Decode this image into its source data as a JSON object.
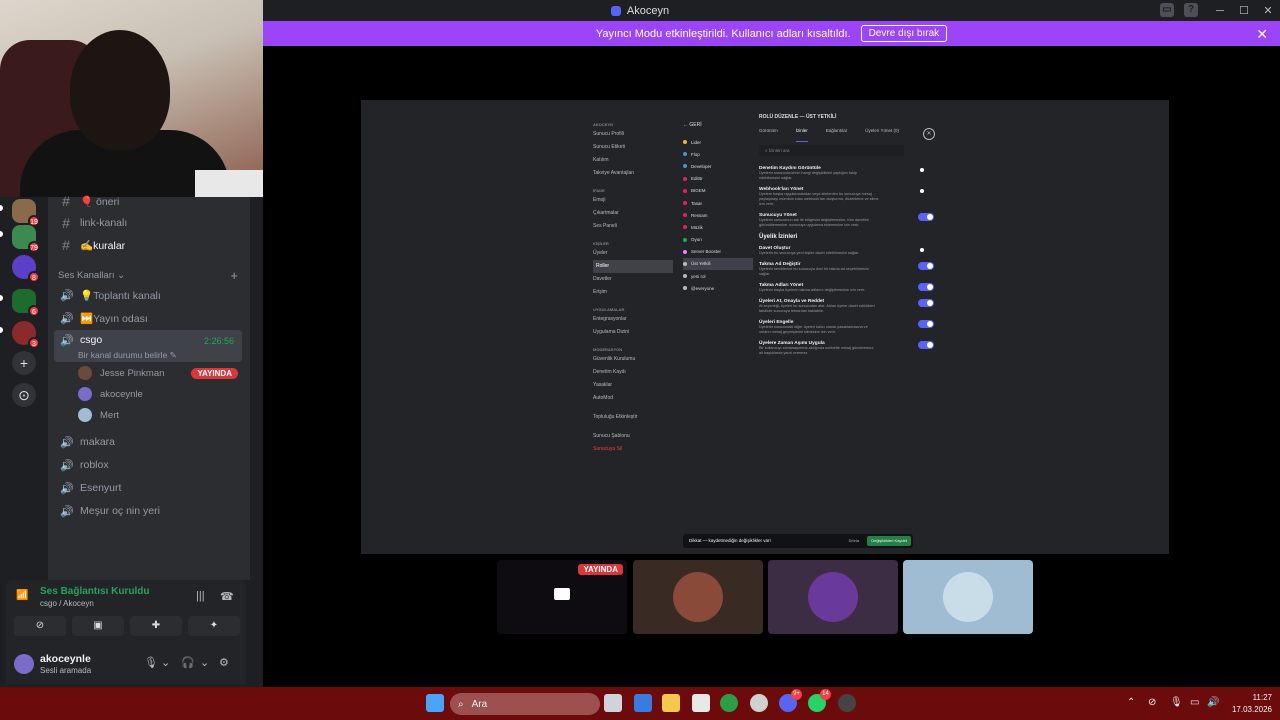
{
  "window": {
    "title": "Akoceyn"
  },
  "banner": {
    "text": "Yayıncı Modu etkinleştirildi. Kullanıcı adları kısaltıldı.",
    "button_label": "Devre dışı bırak",
    "accent": "#9b44f8"
  },
  "server_badges": [
    "19",
    "79",
    "8",
    "6",
    "3"
  ],
  "channels": {
    "text_channels": [
      {
        "label": "🎈 öneri"
      },
      {
        "label": "link-kanalı"
      },
      {
        "label": "✍️kuralar"
      }
    ],
    "voice_category": "Ses Kanalları",
    "voice_channels": [
      {
        "label": "💡Toplantı kanalı"
      },
      {
        "label": "⏭️Yayın odası"
      }
    ],
    "active_channel": {
      "label": "csgo",
      "timer": "2:26:56",
      "status_placeholder": "Bir kanal durumu belirle"
    },
    "members": [
      {
        "name": "Jesse Pinkman",
        "badge": "YAYINDA"
      },
      {
        "name": "akoceynle"
      },
      {
        "name": "Mert"
      }
    ],
    "other_voice_channels": [
      {
        "label": "makara"
      },
      {
        "label": "roblox"
      },
      {
        "label": "Esenyurt"
      },
      {
        "label": "Meşur oç nin yeri"
      }
    ]
  },
  "voice_panel": {
    "status": "Ses Bağlantısı Kuruldu",
    "location": "csgo / Akoceyn",
    "status_color": "#23a55a"
  },
  "user_panel": {
    "name": "akoceynle",
    "status": "Sesli aramada"
  },
  "stream": {
    "nav": {
      "server_header": "AKOCEYN",
      "items_1": [
        "Sunucu Profili",
        "Sunucu Etiketi",
        "Katılım",
        "Takviye Avantajları"
      ],
      "header_2": "İFADE",
      "items_2": [
        "Emoji",
        "Çıkartmalar",
        "Ses Paneli"
      ],
      "header_3": "KİŞİLER",
      "items_3": [
        "Üyeler",
        "Roller",
        "Davetler",
        "Erişim"
      ],
      "header_4": "UYGULAMALAR",
      "items_4": [
        "Entegrasyonlar",
        "Uygulama Dizini"
      ],
      "header_5": "MODERASYON",
      "items_5": [
        "Güvenlik Kurulumu",
        "Denetim Kaydı",
        "Yasaklar",
        "AutoMod"
      ],
      "items_6": [
        "Topluluğu Etkinleştir"
      ],
      "items_7": [
        "Sunucu Şablonu"
      ],
      "delete": "Sunucuyu Sil"
    },
    "roles": {
      "header": "GERİ",
      "list": [
        {
          "name": "Lider",
          "color": "#f0b232"
        },
        {
          "name": "Flop",
          "color": "#3498db"
        },
        {
          "name": "Developer",
          "color": "#3498db"
        },
        {
          "name": "Editör",
          "color": "#e91e63"
        },
        {
          "name": "BIGEM",
          "color": "#e91e63"
        },
        {
          "name": "Tasar",
          "color": "#e91e63"
        },
        {
          "name": "Ressam",
          "color": "#e91e63"
        },
        {
          "name": "Müzik",
          "color": "#e91e63"
        },
        {
          "name": "Oyun",
          "color": "#23a55a"
        },
        {
          "name": "Server Booster",
          "color": "#f47fff"
        },
        {
          "name": "Üst Yetkili",
          "color": "#b5bac1"
        },
        {
          "name": "yeni rol",
          "color": "#b5bac1"
        },
        {
          "name": "@everyone",
          "color": "#b5bac1"
        }
      ]
    },
    "editor": {
      "title": "ROLÜ DÜZENLE — ÜST YETKİLİ",
      "tabs": [
        "Görünüm",
        "İzinler",
        "Bağlantılar",
        "Üyeleri Yönet (0)"
      ],
      "search_placeholder": "İzinleri ara",
      "perms": [
        {
          "title": "Denetim Kaydını Görüntüle",
          "desc": "Üyelerin sunucuda kimin hangi değişiklikleri yaptığını takip edebilmesini sağlar.",
          "on": false
        },
        {
          "title": "Webhook'ları Yönet",
          "desc": "Üyelere başka uygulamalardan veya sitelerden bu sunucuya mesaj paylaşmayı mümkün kılan webhook'ları oluşturma, düzenleme ve silme izni verir.",
          "on": false
        },
        {
          "title": "Sunucuyu Yönet",
          "desc": "Üyelerin sunucunun adı ile bölgesini değiştirmesine, tüm davetleri görüntülemesine, sunucuya uygulama eklemesine izin verir.",
          "on": true
        }
      ],
      "section": "Üyelik İzinleri",
      "perms2": [
        {
          "title": "Davet Oluştur",
          "desc": "Üyelerin bu sunucuya yeni kişiler davet edebilmesini sağlar.",
          "on": false
        },
        {
          "title": "Takma Ad Değiştir",
          "desc": "Üyelerin kendilerine bu sunucuya özel bir takma ad seçebilmesini sağlar.",
          "on": true
        },
        {
          "title": "Takma Adları Yönet",
          "desc": "Üyelerin başka üyelerin takma adlarını değiştirmesine izin verir.",
          "on": true
        },
        {
          "title": "Üyeleri At, Onayla ve Reddet",
          "desc": "At seçeneği, üyeleri bu sunucudan atar. Atılan üyeler davet edildikleri takdirde sunucuya tekrardan katılabilir.",
          "on": true
        },
        {
          "title": "Üyeleri Engelle",
          "desc": "Üyelerin sunucudaki diğer üyeleri kalıcı olarak yasaklamasına ve onların mesaj geçmişlerini silmesine izin verir.",
          "on": true
        },
        {
          "title": "Üyelere Zaman Aşımı Uygula",
          "desc": "Bir kullanıcıyı zamanaşımına aldığında sohbette mesaj gönderemez, alt başlıklarda yanıt veremez.",
          "on": true
        }
      ],
      "esc": "ESC",
      "unsaved": "Dikkat — kaydetmediğin değişiklikler var!",
      "reset": "Sıfırla",
      "save": "Değişiklikleri Kaydet"
    }
  },
  "tiles": {
    "live_label": "YAYINDA"
  },
  "taskbar": {
    "search_label": "Ara",
    "discord_badge": "9+",
    "whatsapp_badge": "14",
    "time": "11:27",
    "date": "17.03.2026"
  }
}
